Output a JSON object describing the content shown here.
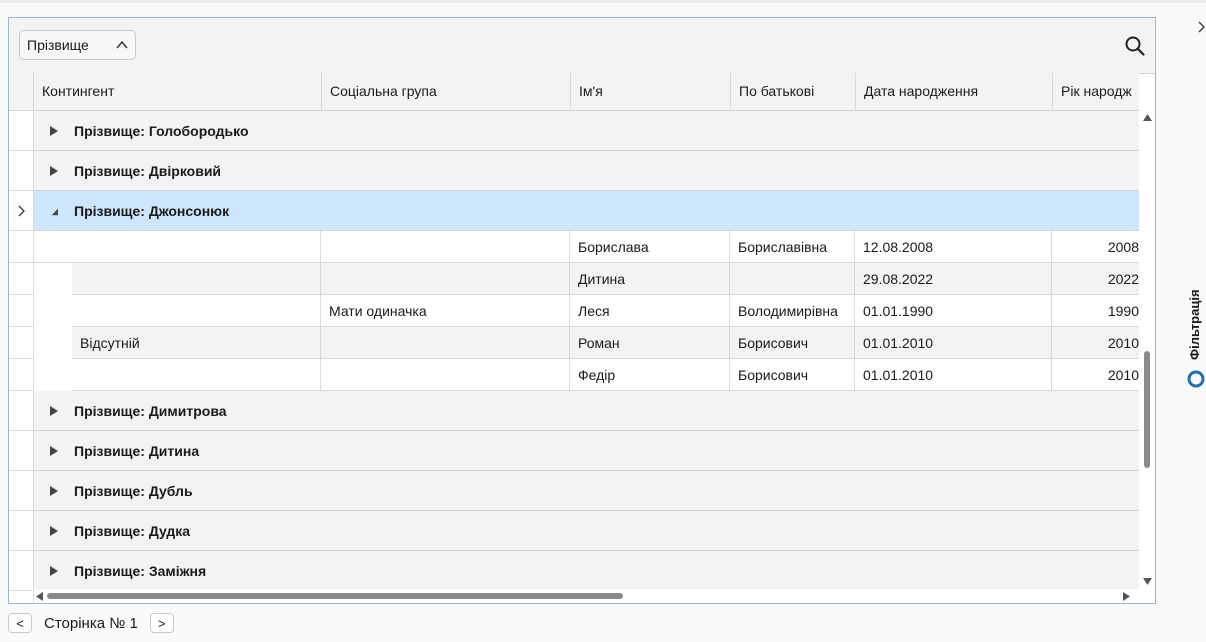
{
  "group_panel": {
    "chip_label": "Прізвище"
  },
  "columns": [
    "Контингент",
    "Соціальна група",
    "Ім'я",
    "По батькові",
    "Дата народження",
    "Рік народж"
  ],
  "groups": [
    {
      "label": "Прізвище: Голобородько",
      "expanded": false
    },
    {
      "label": "Прізвище: Двірковий",
      "expanded": false
    },
    {
      "label": "Прізвище: Джонсонюк",
      "expanded": true,
      "rows": [
        {
          "contingent": "",
          "social_group": "",
          "first_name": "Борислава",
          "patronymic": "Бориславівна",
          "birth_date": "12.08.2008",
          "birth_year": "2008"
        },
        {
          "contingent": "",
          "social_group": "",
          "first_name": "Дитина",
          "patronymic": "",
          "birth_date": "29.08.2022",
          "birth_year": "2022"
        },
        {
          "contingent": "",
          "social_group": "Мати одиначка",
          "first_name": "Леся",
          "patronymic": "Володимирівна",
          "birth_date": "01.01.1990",
          "birth_year": "1990"
        },
        {
          "contingent": "Відсутній",
          "social_group": "",
          "first_name": "Роман",
          "patronymic": "Борисович",
          "birth_date": "01.01.2010",
          "birth_year": "2010"
        },
        {
          "contingent": "",
          "social_group": "",
          "first_name": "Федір",
          "patronymic": "Борисович",
          "birth_date": "01.01.2010",
          "birth_year": "2010"
        }
      ]
    },
    {
      "label": "Прізвище: Димитрова",
      "expanded": false
    },
    {
      "label": "Прізвище: Дитина",
      "expanded": false
    },
    {
      "label": "Прізвище: Дубль",
      "expanded": false
    },
    {
      "label": "Прізвище: Дудка",
      "expanded": false
    },
    {
      "label": "Прізвище: Заміжня",
      "expanded": false
    }
  ],
  "pager": {
    "prev": "<",
    "label": "Сторінка № 1",
    "next": ">"
  },
  "side_panel": {
    "filter_label": "Фільтрація"
  },
  "colors": {
    "selected_group": "#cde6fb",
    "accent": "#1c6fb8",
    "border": "#9db4d4"
  }
}
